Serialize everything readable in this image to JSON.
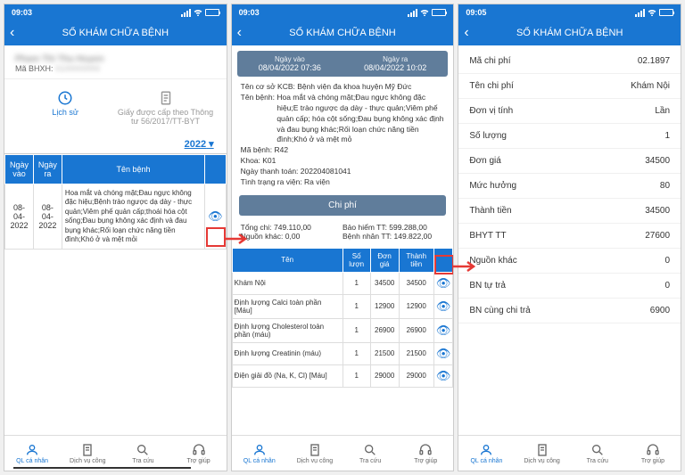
{
  "status": {
    "time1": "09:03",
    "time2": "09:03",
    "time3": "09:05"
  },
  "header": {
    "title": "SỔ KHÁM CHỮA BỆNH"
  },
  "nav": [
    {
      "label": "QL cá nhân"
    },
    {
      "label": "Dịch vụ công"
    },
    {
      "label": "Tra cứu"
    },
    {
      "label": "Trợ giúp"
    }
  ],
  "screen1": {
    "user_name": "Pham Thi Thu Huyen",
    "bhxh_label": "Mã BHXH:",
    "bhxh_value": "0100000000",
    "tabs": {
      "history": "Lịch sử",
      "cert": "Giấy được cấp theo Thông tư 56/2017/TT-BYT"
    },
    "year": "2022",
    "cols": {
      "in": "Ngày vào",
      "out": "Ngày ra",
      "disease": "Tên bệnh"
    },
    "row": {
      "in": "08-04-2022",
      "out": "08-04-2022",
      "disease": "Hoa mắt và chóng mặt;Đau ngực không đặc hiệu;Bệnh trào ngược dạ dày - thực quản;Viêm phế quản cấp;thoái hóa cột sống;Đau bụng không xác định và đau bụng khác;Rối loạn chức năng tiền đình;Khó ở và mệt mỏi"
    }
  },
  "screen2": {
    "in_label": "Ngày vào",
    "in_val": "08/04/2022 07:36",
    "out_label": "Ngày ra",
    "out_val": "08/04/2022 10:02",
    "kcb_label": "Tên cơ sở KCB:",
    "kcb_val": "Bệnh viện đa khoa huyện Mỹ Đức",
    "benh_label": "Tên bệnh:",
    "benh_val": "Hoa mắt và chóng mặt;Đau ngực không đặc hiệu;E trào ngược dạ dày - thực quản;Viêm phế quản cấp; hóa cột sống;Đau bụng không xác định và đau bụng khác;Rối loạn chức năng tiền đình;Khó ở và mệt mỏ",
    "ma_benh": "Mã bệnh: R42",
    "khoa": "Khoa: K01",
    "ngay_tt": "Ngày thanh toán: 202204081041",
    "tinh_trang": "Tình trạng ra viện: Ra viện",
    "chi_phi_btn": "Chi phí",
    "sum_tong": "Tổng chi: 749.110,00",
    "sum_nguon": "Nguồn khác: 0,00",
    "sum_bhtt": "Bảo hiểm TT: 599.288,00",
    "sum_bntt": "Bệnh nhân TT: 149.822,00",
    "svc_cols": {
      "name": "Tên",
      "qty": "Số lượn",
      "price": "Đơn giá",
      "total": "Thành tiền"
    },
    "svc": [
      {
        "name": "Khám Nội",
        "qty": "1",
        "price": "34500",
        "total": "34500"
      },
      {
        "name": "Định lượng Calci toàn phần [Máu]",
        "qty": "1",
        "price": "12900",
        "total": "12900"
      },
      {
        "name": "Định lượng Cholesterol toàn phần (máu)",
        "qty": "1",
        "price": "26900",
        "total": "26900"
      },
      {
        "name": "Định lượng Creatinin (máu)",
        "qty": "1",
        "price": "21500",
        "total": "21500"
      },
      {
        "name": "Điện giải đồ (Na, K, Cl) [Máu]",
        "qty": "1",
        "price": "29000",
        "total": "29000"
      }
    ]
  },
  "screen3": {
    "rows": [
      {
        "k": "Mã chi phí",
        "v": "02.1897"
      },
      {
        "k": "Tên chi phí",
        "v": "Khám Nội"
      },
      {
        "k": "Đơn vị tính",
        "v": "Lần"
      },
      {
        "k": "Số lượng",
        "v": "1"
      },
      {
        "k": "Đơn giá",
        "v": "34500"
      },
      {
        "k": "Mức hưởng",
        "v": "80"
      },
      {
        "k": "Thành tiền",
        "v": "34500"
      },
      {
        "k": "BHYT TT",
        "v": "27600"
      },
      {
        "k": "Nguồn khác",
        "v": "0"
      },
      {
        "k": "BN tự trả",
        "v": "0"
      },
      {
        "k": "BN cùng chi trả",
        "v": "6900"
      }
    ]
  }
}
